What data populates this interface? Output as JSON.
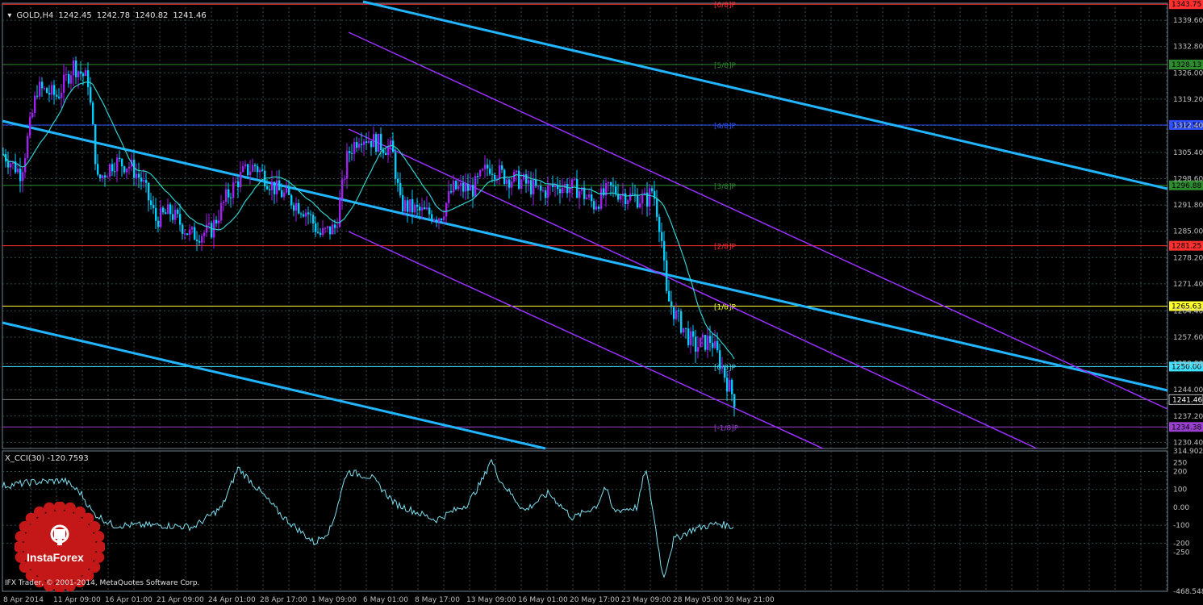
{
  "header": {
    "symbol": "GOLD,H4",
    "open": "1242.45",
    "high": "1242.78",
    "low": "1240.82",
    "close": "1241.46"
  },
  "indicator": {
    "title": "X_CCI(30) -120.7593",
    "scale_labels": [
      "314.9022",
      "250",
      "200",
      "100",
      "0.00",
      "-100",
      "-200",
      "-250",
      "-468.5486"
    ]
  },
  "footer": {
    "copyright": "IFX Trader, © 2001-2014, MetaQuotes Software Corp.",
    "logo_text": "InstaForex"
  },
  "time_axis": [
    "8 Apr 2014",
    "11 Apr 09:00",
    "16 Apr 01:00",
    "21 Apr 09:00",
    "24 Apr 01:00",
    "28 Apr 17:00",
    "1 May 09:00",
    "6 May 01:00",
    "8 May 17:00",
    "13 May 09:00",
    "16 May 01:00",
    "20 May 17:00",
    "23 May 09:00",
    "28 May 05:00",
    "30 May 21:00"
  ],
  "price_axis": [
    "1339.60",
    "1332.80",
    "1326.00",
    "1319.20",
    "1312.40",
    "1305.40",
    "1298.60",
    "1291.80",
    "1285.00",
    "1278.20",
    "1271.40",
    "1264.40",
    "1257.60",
    "1250.80",
    "1244.00",
    "1237.20",
    "1230.40"
  ],
  "murrey_levels": [
    {
      "label": "[6/8]P",
      "price": "1343.75",
      "color": "#ff3030"
    },
    {
      "label": "[5/8]P",
      "price": "1328.13",
      "color": "#2e8b2e"
    },
    {
      "label": "[4/8]P",
      "price": "1312.50",
      "color": "#3050ff"
    },
    {
      "label": "[3/8]P",
      "price": "1296.88",
      "color": "#2e8b2e"
    },
    {
      "label": "[2/8]P",
      "price": "1281.25",
      "color": "#ff3030"
    },
    {
      "label": "[1/8]P",
      "price": "1265.63",
      "color": "#ffff30"
    },
    {
      "label": "[0/8]P",
      "price": "1250.00",
      "color": "#40e0ff"
    },
    {
      "label": "[-1/8]P",
      "price": "1234.38",
      "color": "#9a40d0"
    }
  ],
  "current_price": "1241.46",
  "colors": {
    "grid": "#2f4f4f",
    "bull": "#a020f0",
    "bear": "#00ccff",
    "ma": "#30d0d0",
    "channel_blue": "#22b5ff",
    "channel_purple": "#9b30ff",
    "cci": "#7fe0f0"
  }
}
